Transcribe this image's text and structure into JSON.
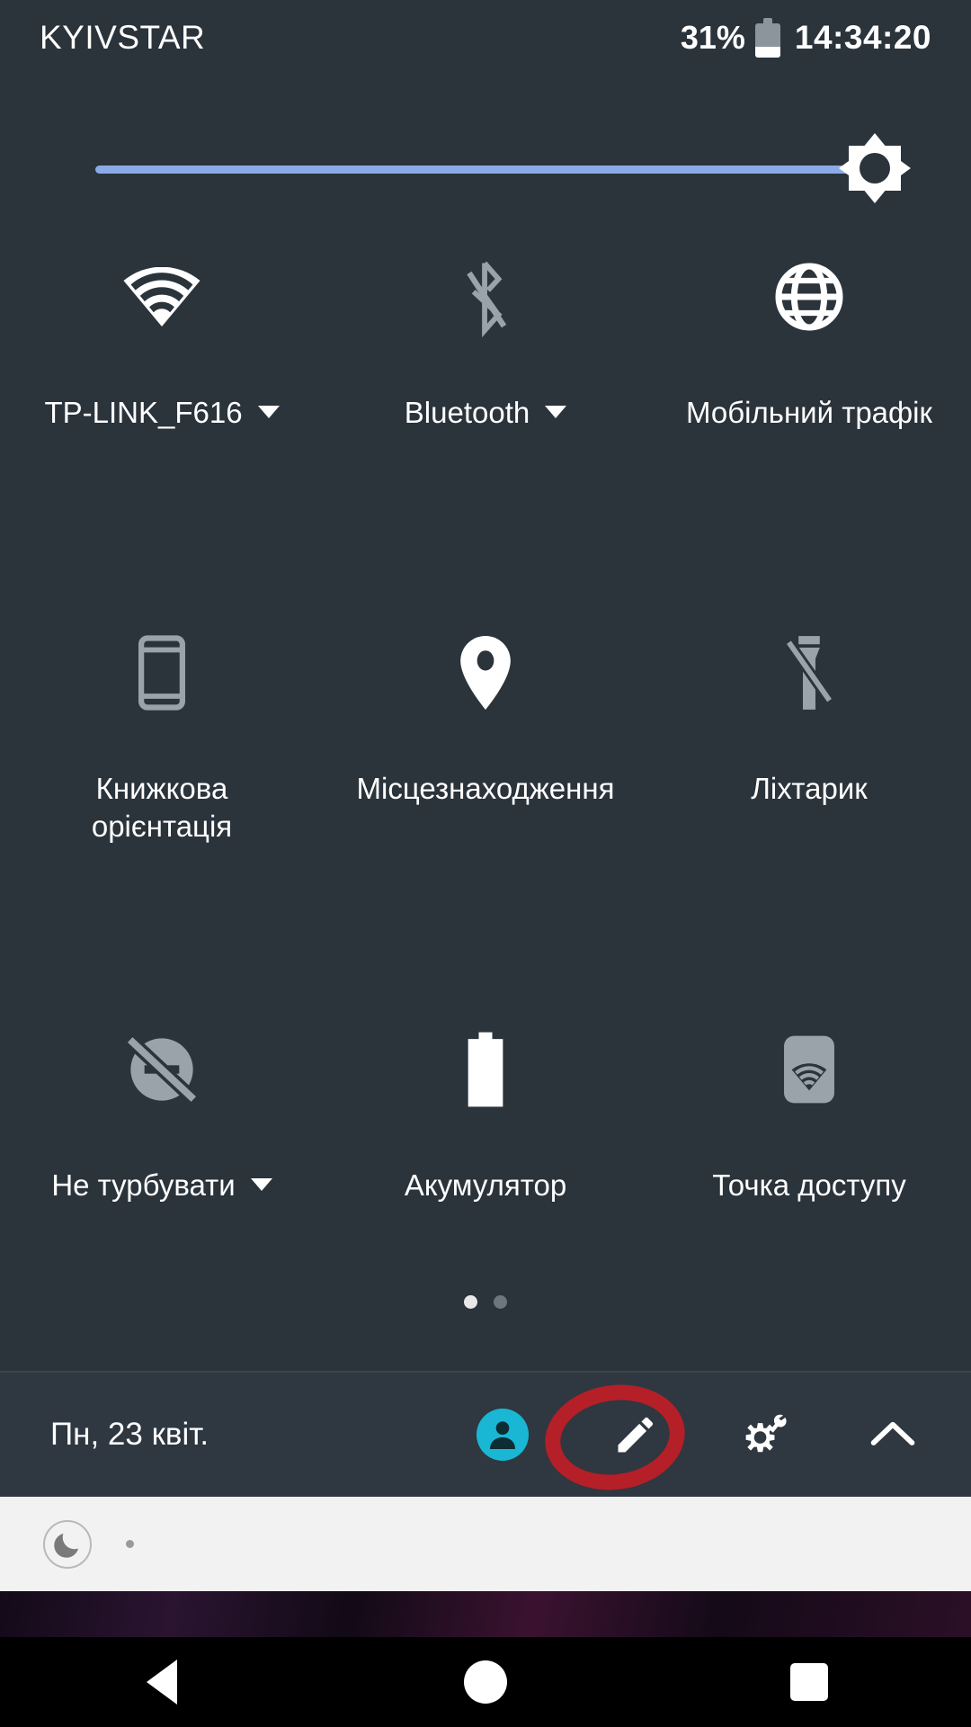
{
  "statusbar": {
    "carrier": "KYIVSTAR",
    "battery_percent": "31%",
    "battery_icon": "battery-icon",
    "clock": "14:34:20"
  },
  "brightness": {
    "icon": "brightness-sun-icon",
    "level_percent": 92,
    "track_color": "#8aaae8"
  },
  "tiles": [
    [
      {
        "icon": "wifi-icon",
        "label": "TP-LINK_F616",
        "state": "on",
        "has_caret": true
      },
      {
        "icon": "bluetooth-off-icon",
        "label": "Bluetooth",
        "state": "off",
        "has_caret": true
      },
      {
        "icon": "globe-icon",
        "label": "Мобільний трафік",
        "state": "on",
        "has_caret": false
      }
    ],
    [
      {
        "icon": "screen-rotation-portrait-icon",
        "label": "Книжкова орієнтація",
        "state": "off",
        "has_caret": false
      },
      {
        "icon": "location-pin-icon",
        "label": "Місцезнаходження",
        "state": "on",
        "has_caret": false
      },
      {
        "icon": "flashlight-off-icon",
        "label": "Ліхтарик",
        "state": "off",
        "has_caret": false
      }
    ],
    [
      {
        "icon": "do-not-disturb-icon",
        "label": "Не турбувати",
        "state": "off",
        "has_caret": true
      },
      {
        "icon": "battery-full-icon",
        "label": "Акумулятор",
        "state": "on",
        "has_caret": false
      },
      {
        "icon": "hotspot-icon",
        "label": "Точка доступу",
        "state": "off",
        "has_caret": false
      }
    ]
  ],
  "pager": {
    "pages": 2,
    "active": 1
  },
  "footer": {
    "date": "Пн, 23 квіт.",
    "avatar_icon": "user-avatar-icon",
    "avatar_color": "#19b7d4",
    "edit_icon": "pencil-edit-icon",
    "settings_icon": "settings-gear-wrench-icon",
    "collapse_icon": "chevron-up-icon"
  },
  "annotation": {
    "shape": "red-circle",
    "color": "#b51f28",
    "targets": "settings-gear-wrench-icon"
  },
  "notification_shade": {
    "moon_icon": "crescent-moon-icon",
    "overflow_dot": "overflow-dot-icon"
  },
  "navbar": {
    "back_icon": "nav-back-icon",
    "home_icon": "nav-home-icon",
    "recents_icon": "nav-recents-icon"
  }
}
